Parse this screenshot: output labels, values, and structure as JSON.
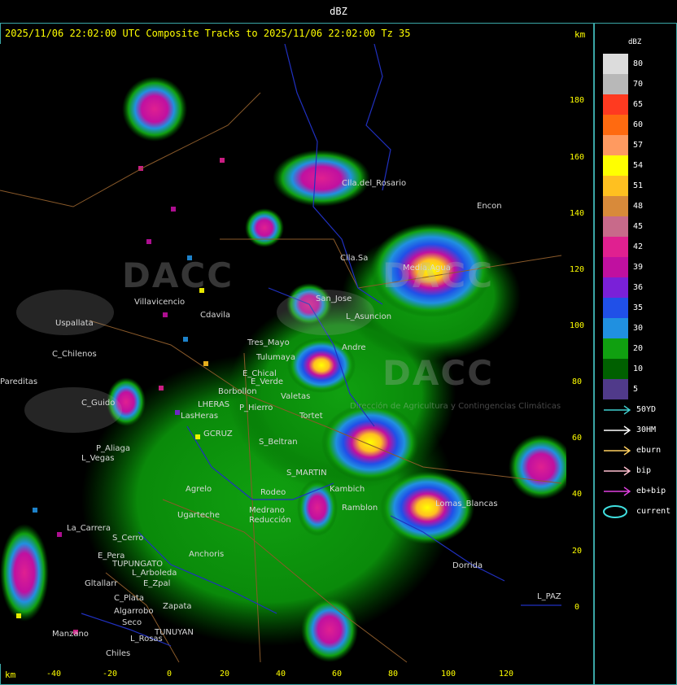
{
  "header": {
    "title": "dBZ"
  },
  "subtitle": "2025/11/06 22:02:00 UTC Composite Tracks to 2025/11/06 22:02:00 Tz 35",
  "axis": {
    "unit_label_top": "km",
    "unit_label_bottom": "km",
    "y_ticks": [
      "180",
      "160",
      "140",
      "120",
      "100",
      "80",
      "60",
      "40",
      "20",
      "0"
    ],
    "x_ticks": [
      "-40",
      "-20",
      "0",
      "20",
      "40",
      "60",
      "80",
      "100",
      "120"
    ]
  },
  "legend": {
    "title": "dBZ",
    "bins": [
      {
        "label": "80",
        "color": "#dcdcdc"
      },
      {
        "label": "70",
        "color": "#b8b8b8"
      },
      {
        "label": "65",
        "color": "#ff3a20"
      },
      {
        "label": "60",
        "color": "#ff6a10"
      },
      {
        "label": "57",
        "color": "#ff9a60"
      },
      {
        "label": "54",
        "color": "#ffff00"
      },
      {
        "label": "51",
        "color": "#ffc020"
      },
      {
        "label": "48",
        "color": "#d88a3a"
      },
      {
        "label": "45",
        "color": "#c86a8a"
      },
      {
        "label": "42",
        "color": "#e02090"
      },
      {
        "label": "39",
        "color": "#c010a0"
      },
      {
        "label": "36",
        "color": "#7a20d8"
      },
      {
        "label": "35",
        "color": "#2050e8"
      },
      {
        "label": "30",
        "color": "#2090e0"
      },
      {
        "label": "20",
        "color": "#10a010"
      },
      {
        "label": "10",
        "color": "#006000"
      },
      {
        "label": "5",
        "color": "#503a8a"
      }
    ],
    "tracks": [
      {
        "label": "50YD",
        "color": "#40d0d0"
      },
      {
        "label": "30HM",
        "color": "#ffffff"
      },
      {
        "label": "eburn",
        "color": "#ffd060"
      },
      {
        "label": "bip",
        "color": "#ffc0d0"
      },
      {
        "label": "eb+bip",
        "color": "#e040e0"
      },
      {
        "label": "current",
        "color": "#40e0e0"
      }
    ]
  },
  "places": [
    "Clla.del_Rosario",
    "Encon",
    "Clla.Sa",
    "Media.Agua",
    "San_Jose",
    "L_Asuncion",
    "Villavicencio",
    "Cdavila",
    "Uspallata",
    "C_Chilenos",
    "Tres_Mayo",
    "Tulumaya",
    "Andre",
    "E_Chical",
    "E_Verde",
    "Borbollon",
    "P_Hierro",
    "Valetas",
    "C_Guido",
    "LHERAS",
    "Tortet",
    "LasHeras",
    "P_Aliaga",
    "L_Vegas",
    "GCRUZ",
    "S_Beltran",
    "S_MARTIN",
    "Agrelo",
    "Ugarteche",
    "Rodeo",
    "Kambich",
    "Lomas_Blancas",
    "Ramblon",
    "Medrano",
    "Reducción",
    "La_Carrera",
    "S_Cerro",
    "E_Pera",
    "TUPUNGATO",
    "Anchoris",
    "L_Arboleda",
    "E_Zpal",
    "Gltallarr",
    "C_Plata",
    "Zapata",
    "Dorrida",
    "L_PAZ",
    "Algarrobo",
    "Seco",
    "TUNUYAN",
    "Manzano",
    "L_Rosas",
    "Pareditas",
    "Chiles"
  ],
  "watermark": [
    "DACC",
    "DACC",
    "DACC"
  ],
  "watermark_sub": "Dirección de Agricultura y Contingencias Climáticas"
}
